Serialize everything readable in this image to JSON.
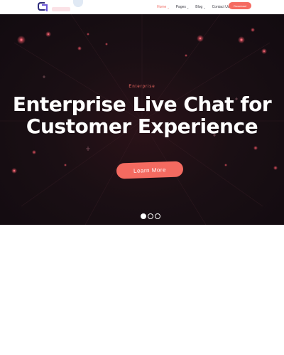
{
  "header": {
    "logo": "logo-icon",
    "nav": [
      {
        "label": "Home",
        "active": true
      },
      {
        "label": "Pages",
        "active": false
      },
      {
        "label": "Blog",
        "active": false
      },
      {
        "label": "Contact Us",
        "active": false
      }
    ],
    "cta_label": "Download"
  },
  "hero": {
    "eyebrow": "Enterprise",
    "title_line1": "Enterprise Live Chat for",
    "title_line2": "Customer Experience",
    "button_label": "Learn More",
    "slides": {
      "count": 3,
      "active_index": 0
    }
  },
  "colors": {
    "accent": "#f56b61",
    "hero_bg": "#150d12",
    "text_dark": "#3b3b44"
  }
}
